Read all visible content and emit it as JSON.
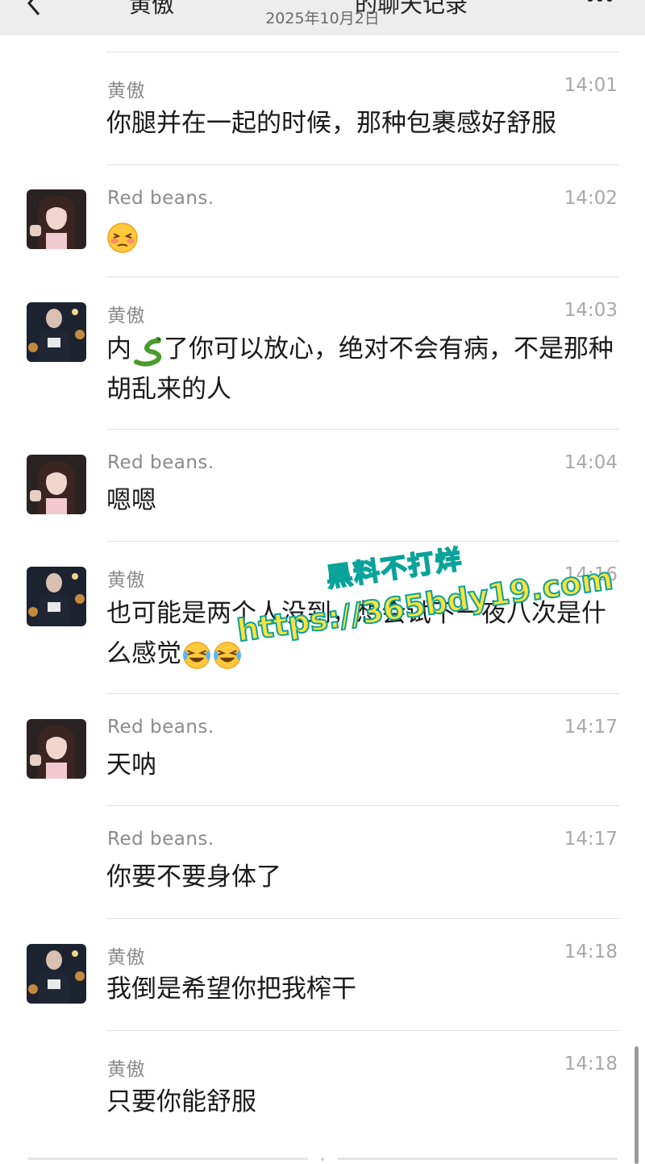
{
  "header": {
    "title_left": "黄傲",
    "title_right": "的聊天记录",
    "date": "2025年10月2日"
  },
  "messages": [
    {
      "sender": "黄傲",
      "time": "14:01",
      "text": "你腿并在一起的时候，那种包裹感好舒服",
      "avatar": "none"
    },
    {
      "sender": "Red  beans.",
      "time": "14:02",
      "text": "",
      "emoji": "blushing-face",
      "avatar": "female-avatar"
    },
    {
      "sender": "黄傲",
      "time": "14:03",
      "text_before": "内",
      "emoji": "snake",
      "text_after": "了你可以放心，绝对不会有病，不是那种胡乱来的人",
      "avatar": "male-avatar"
    },
    {
      "sender": "Red  beans.",
      "time": "14:04",
      "text": "嗯嗯",
      "avatar": "female-avatar"
    },
    {
      "sender": "黄傲",
      "time": "14:16",
      "text": "也可能是两个人没到，想会试下一夜八次是什么感觉",
      "emoji": "laughing-crying-face",
      "avatar": "male-avatar"
    },
    {
      "sender": "Red  beans.",
      "time": "14:17",
      "text": "天呐",
      "avatar": "female-avatar"
    },
    {
      "sender": "Red  beans.",
      "time": "14:17",
      "text": "你要不要身体了",
      "avatar": "none"
    },
    {
      "sender": "黄傲",
      "time": "14:18",
      "text": "我倒是希望你把我榨干",
      "avatar": "male-avatar"
    },
    {
      "sender": "黄傲",
      "time": "14:18",
      "text": "只要你能舒服",
      "avatar": "none"
    }
  ],
  "watermark": {
    "line1": "黑料不打烊",
    "line2": "https://365bdy19.com"
  },
  "colors": {
    "header_bg": "#ededed",
    "separator": "#e2e2e2",
    "sender": "#8a8a8a",
    "time": "#a8a8a8",
    "watermark_fill": "#ffe23a",
    "watermark_stroke": "#0aa39b"
  }
}
